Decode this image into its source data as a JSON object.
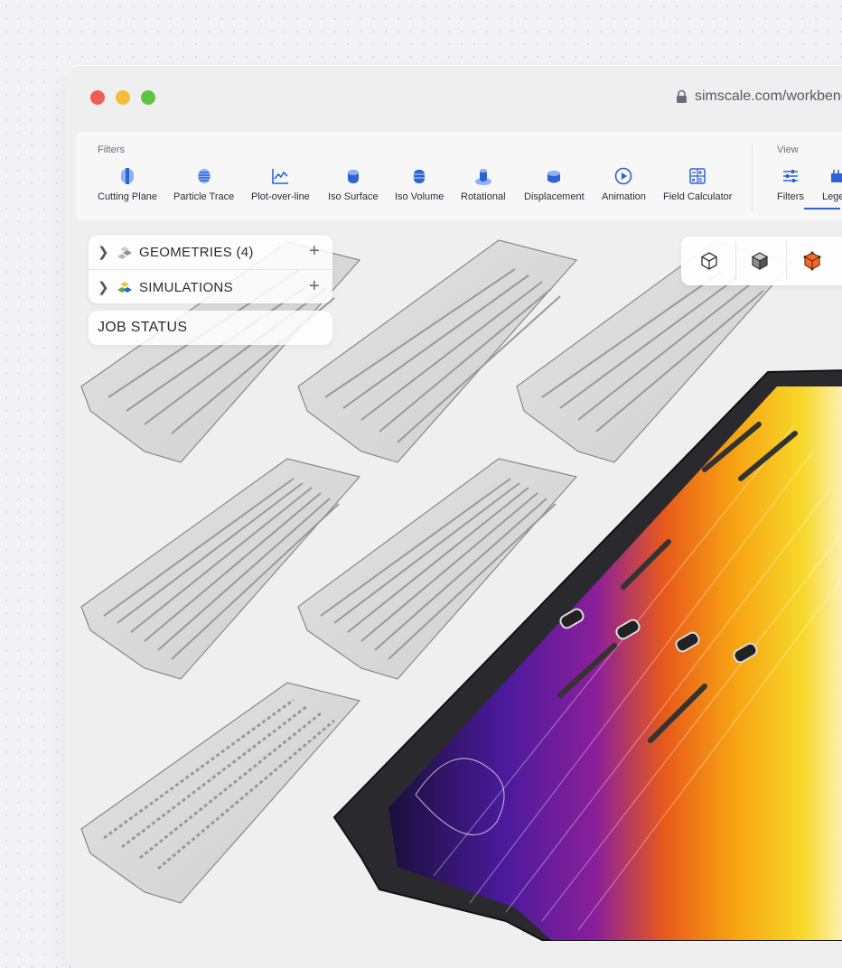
{
  "browser": {
    "url": "simscale.com/workbench",
    "traffic_lights": {
      "close": "#ee5e57",
      "minimize": "#f3be3e",
      "zoom": "#5ec443"
    }
  },
  "toolbar": {
    "filters_label": "Filters",
    "view_label": "View",
    "filters": [
      {
        "label": "Cutting Plane",
        "icon": "cutting-plane-icon"
      },
      {
        "label": "Particle Trace",
        "icon": "particle-trace-icon"
      },
      {
        "label": "Plot-over-line",
        "icon": "plot-over-line-icon"
      },
      {
        "label": "Iso Surface",
        "icon": "iso-surface-icon"
      },
      {
        "label": "Iso Volume",
        "icon": "iso-volume-icon"
      },
      {
        "label": "Rotational",
        "icon": "rotational-icon"
      },
      {
        "label": "Displacement",
        "icon": "displacement-icon"
      },
      {
        "label": "Animation",
        "icon": "animation-icon"
      },
      {
        "label": "Field Calculator",
        "icon": "field-calculator-icon"
      }
    ],
    "view": [
      {
        "label": "Filters",
        "icon": "sliders-icon"
      },
      {
        "label": "Legend",
        "icon": "legend-icon",
        "active": true
      }
    ],
    "accent": "#2e63d6"
  },
  "tree": {
    "geometries_label": "GEOMETRIES",
    "geometries_count": "(4)",
    "simulations_label": "SIMULATIONS",
    "job_status_label": "JOB STATUS"
  },
  "view_cube": {
    "buttons": [
      "wireframe-cube-icon",
      "solid-cube-icon",
      "orientation-cube-icon"
    ]
  }
}
